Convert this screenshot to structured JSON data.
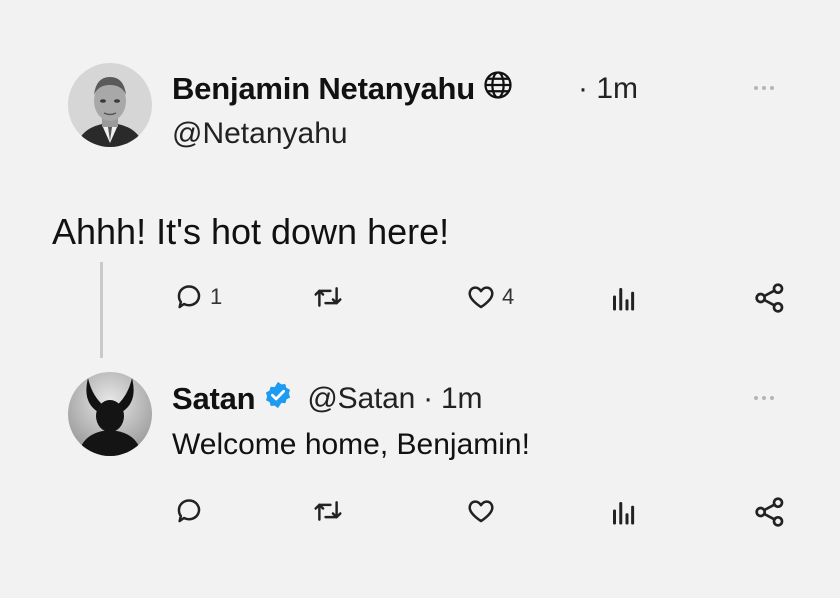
{
  "colors": {
    "background": "#f2f2f2",
    "verified": "#1d9bf0",
    "text": "#111111",
    "icon": "#333333"
  },
  "tweet": {
    "author_name": "Benjamin Netanyahu",
    "badge_icon": "globe-icon",
    "time": "· 1m",
    "handle": "@Netanyahu",
    "text": "Ahhh! It's hot down here!",
    "actions": {
      "reply_count": "1",
      "like_count": "4"
    }
  },
  "reply": {
    "author_name": "Satan",
    "badge_icon": "verified-badge-icon",
    "handle": "@Satan",
    "time": "· 1m",
    "text": "Welcome home, Benjamin!"
  }
}
